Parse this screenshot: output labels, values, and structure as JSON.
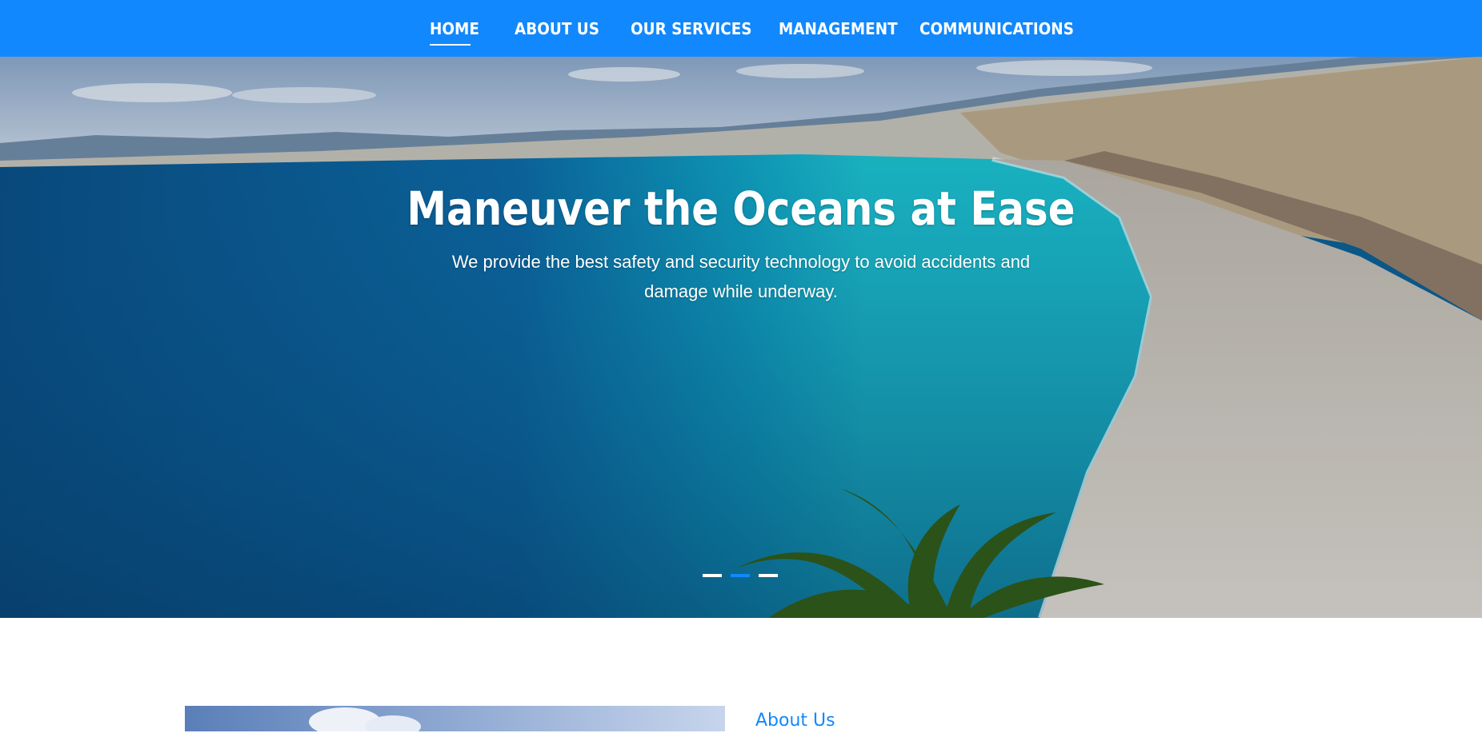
{
  "nav": {
    "items": [
      {
        "label": "HOME"
      },
      {
        "label": "ABOUT US"
      },
      {
        "label": "OUR SERVICES"
      },
      {
        "label": "MANAGEMENT"
      },
      {
        "label": "COMMUNICATIONS"
      }
    ],
    "active_item": "HOME"
  },
  "hero": {
    "title": "Maneuver the Oceans at Ease",
    "subtitle": "We provide the best safety and security technology to avoid accidents and damage while underway.",
    "carousel": {
      "slide_count": 3,
      "active_slide": 2
    }
  },
  "about": {
    "heading": "About Us"
  },
  "colors": {
    "brand_blue": "#1188fd",
    "text_white": "#ffffff"
  }
}
